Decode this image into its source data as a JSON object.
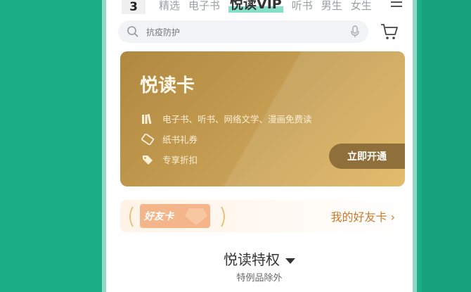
{
  "status": {
    "badge": "3"
  },
  "tabs": [
    {
      "label": "精选",
      "active": false
    },
    {
      "label": "电子书",
      "active": false
    },
    {
      "label": "悦读VIP",
      "active": true
    },
    {
      "label": "听书",
      "active": false
    },
    {
      "label": "男生",
      "active": false
    },
    {
      "label": "女生",
      "active": false
    }
  ],
  "icons": {
    "menu": "menu-icon",
    "search": "search-icon",
    "mic": "microphone-icon",
    "cart": "cart-icon"
  },
  "search": {
    "placeholder": "抗疫防护"
  },
  "vip_card": {
    "title": "悦读卡",
    "features": [
      {
        "icon": "books-icon",
        "text": "电子书、听书、网络文学、漫画免费读"
      },
      {
        "icon": "ticket-icon",
        "text": "纸书礼券"
      },
      {
        "icon": "tag-icon",
        "text": "专享折扣"
      }
    ],
    "button_label": "立即开通"
  },
  "friend_card": {
    "badge_label": "好友卡",
    "link_label": "我的好友卡"
  },
  "privilege": {
    "title": "悦读特权",
    "subtitle": "特例品除外"
  },
  "colors": {
    "background": "#1aad86",
    "active_tab_highlight": "#86e0c8",
    "card_gold": "#c7a055",
    "friend_link": "#c77a2a"
  }
}
